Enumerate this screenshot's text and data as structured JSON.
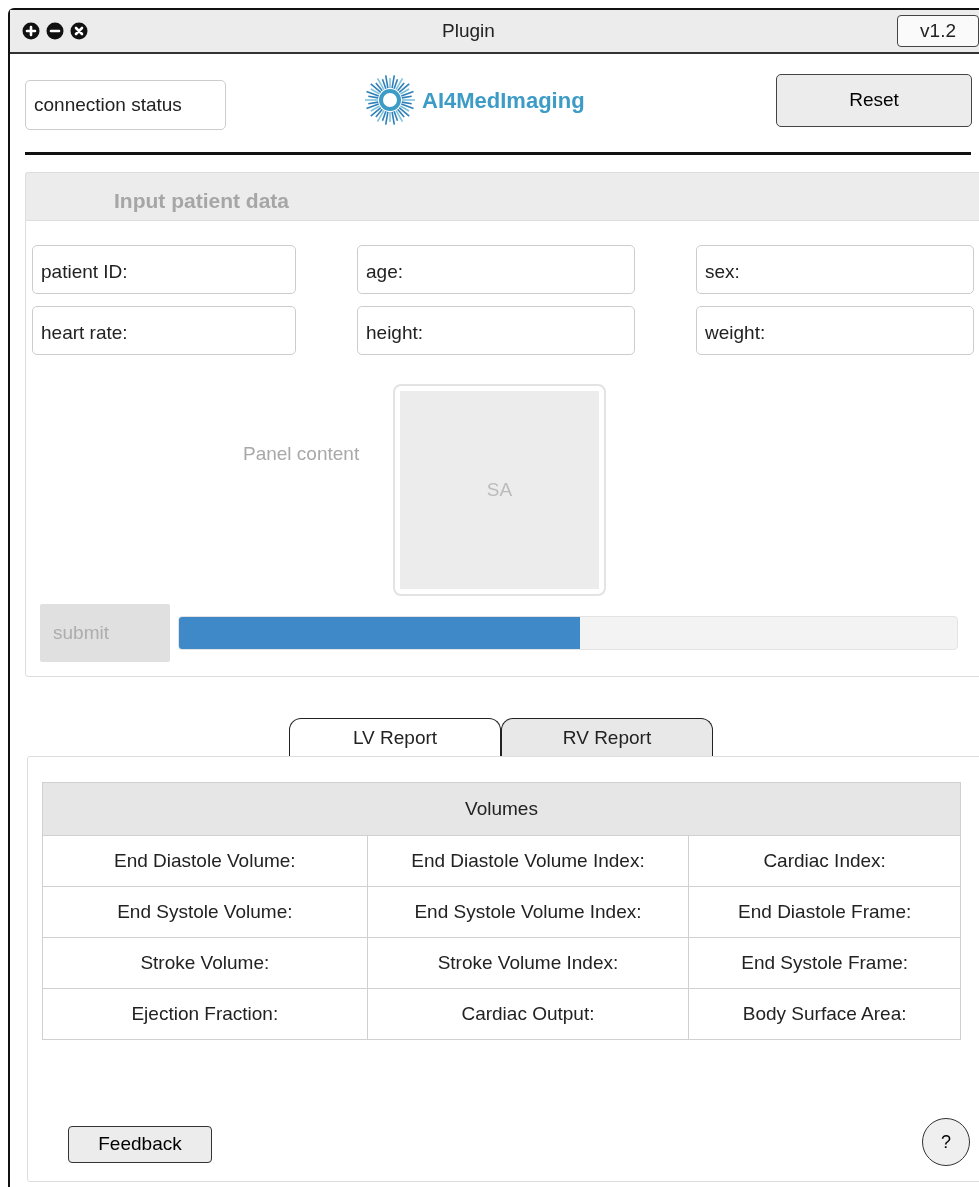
{
  "window": {
    "title": "Plugin",
    "version": "v1.2"
  },
  "header": {
    "connection_status": "connection status",
    "logo_text": "AI4MedImaging",
    "reset_button": "Reset"
  },
  "input_panel": {
    "title": "Input patient data",
    "fields": [
      {
        "label": "patient ID:"
      },
      {
        "label": "age:"
      },
      {
        "label": "sex:"
      },
      {
        "label": "heart rate:"
      },
      {
        "label": "height:"
      },
      {
        "label": "weight:"
      }
    ],
    "panel_content": "Panel content",
    "image_label": "SA",
    "submit": {
      "label": "submit",
      "disabled": true
    },
    "progress": {
      "level": 0.515
    }
  },
  "tabs": [
    {
      "label": "LV Report",
      "selected": true
    },
    {
      "label": "RV Report",
      "selected": false
    }
  ],
  "report": {
    "title": "Volumes",
    "rows": [
      [
        "End Diastole Volume:",
        "End Diastole Volume Index:",
        "Cardiac Index:"
      ],
      [
        "End Systole Volume:",
        "End Systole Volume Index:",
        "End Diastole Frame:"
      ],
      [
        "Stroke Volume:",
        "Stroke Volume Index:",
        "End Systole Frame:"
      ],
      [
        "Ejection Fraction:",
        "Cardiac Output:",
        "Body Surface Area:"
      ]
    ]
  },
  "feedback_button": "Feedback",
  "help_button": "?"
}
